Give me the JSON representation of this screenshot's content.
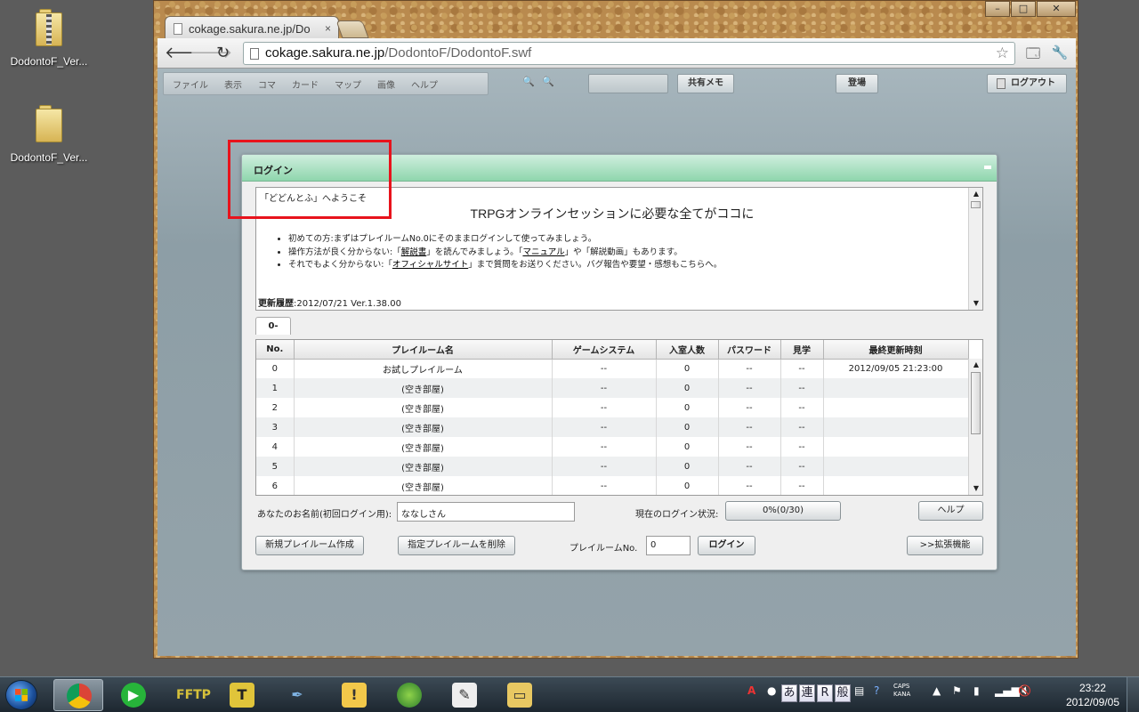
{
  "desktop": {
    "icons": [
      {
        "label": "DodontoF_Ver...",
        "kind": "zip-folder"
      },
      {
        "label": "DodontoF_Ver...",
        "kind": "folder"
      }
    ]
  },
  "browser": {
    "tab_title": "cokage.sakura.ne.jp/Do",
    "url_host": "cokage.sakura.ne.jp",
    "url_path": "/DodontoF/DodontoF.swf",
    "icons": {
      "back": "back-arrow-icon",
      "forward": "forward-arrow-icon",
      "reload": "reload-icon",
      "bookmark": "star-icon",
      "extension": "extension-icon",
      "settings": "wrench-icon"
    }
  },
  "app": {
    "menu": [
      "ファイル",
      "表示",
      "コマ",
      "カード",
      "マップ",
      "画像",
      "ヘルプ"
    ],
    "buttons": {
      "shared_memo": "共有メモ",
      "enter": "登場",
      "logout": "ログアウト"
    }
  },
  "login": {
    "title": "ログイン",
    "greeting": "「どどんとふ」へようこそ",
    "headline": "TRPGオンラインセッションに必要な全てがココに",
    "bullets": [
      {
        "pre": "初めての方:まずはプレイルームNo.0にそのままログインして使ってみましょう。",
        "link1": "",
        "mid": "",
        "link2": "",
        "post": ""
      },
      {
        "pre": "操作方法が良く分からない:「",
        "link1": "解説書",
        "mid": "」を読んでみましょう。「",
        "link2": "マニュアル",
        "post": "」や「解説動画」もあります。"
      },
      {
        "pre": "それでもよく分からない:「",
        "link1": "オフィシャルサイト",
        "mid": "」まで質問をお送りください。バグ報告や要望・感想もこちらへ。",
        "link2": "",
        "post": ""
      }
    ],
    "history_label": "更新履歴",
    "history_value": ":2012/07/21 Ver.1.38.00",
    "room_tab": "0-",
    "columns": [
      "No.",
      "プレイルーム名",
      "ゲームシステム",
      "入室人数",
      "パスワード",
      "見学",
      "最終更新時刻"
    ],
    "rooms": [
      {
        "no": "0",
        "name": "お試しプレイルーム",
        "system": "--",
        "count": "0",
        "password": "--",
        "watch": "--",
        "updated": "2012/09/05 21:23:00"
      },
      {
        "no": "1",
        "name": "(空き部屋)",
        "system": "--",
        "count": "0",
        "password": "--",
        "watch": "--",
        "updated": ""
      },
      {
        "no": "2",
        "name": "(空き部屋)",
        "system": "--",
        "count": "0",
        "password": "--",
        "watch": "--",
        "updated": ""
      },
      {
        "no": "3",
        "name": "(空き部屋)",
        "system": "--",
        "count": "0",
        "password": "--",
        "watch": "--",
        "updated": ""
      },
      {
        "no": "4",
        "name": "(空き部屋)",
        "system": "--",
        "count": "0",
        "password": "--",
        "watch": "--",
        "updated": ""
      },
      {
        "no": "5",
        "name": "(空き部屋)",
        "system": "--",
        "count": "0",
        "password": "--",
        "watch": "--",
        "updated": ""
      },
      {
        "no": "6",
        "name": "(空き部屋)",
        "system": "--",
        "count": "0",
        "password": "--",
        "watch": "--",
        "updated": ""
      }
    ],
    "name_label": "あなたのお名前(初回ログイン用):",
    "name_value": "ななしさん",
    "status_label": "現在のログイン状況:",
    "status_value": "0%(0/30)",
    "help_button": "ヘルプ",
    "new_room_button": "新規プレイルーム作成",
    "delete_room_button": "指定プレイルームを削除",
    "room_no_label": "プレイルームNo.",
    "room_no_value": "0",
    "login_button": "ログイン",
    "extended_button": ">>拡張機能"
  },
  "taskbar": {
    "apps": [
      "chrome",
      "evernote",
      "ffftp",
      "text-editor",
      "quill-pen",
      "notifier",
      "globe",
      "notepad",
      "file-explorer"
    ],
    "ime": [
      "あ",
      "連",
      "R",
      "般"
    ],
    "caps": "CAPS",
    "kana": "KANA",
    "time": "23:22",
    "date": "2012/09/05"
  },
  "colors": {
    "panel_header": "#8fd6ad",
    "highlight": "#e8131c"
  }
}
